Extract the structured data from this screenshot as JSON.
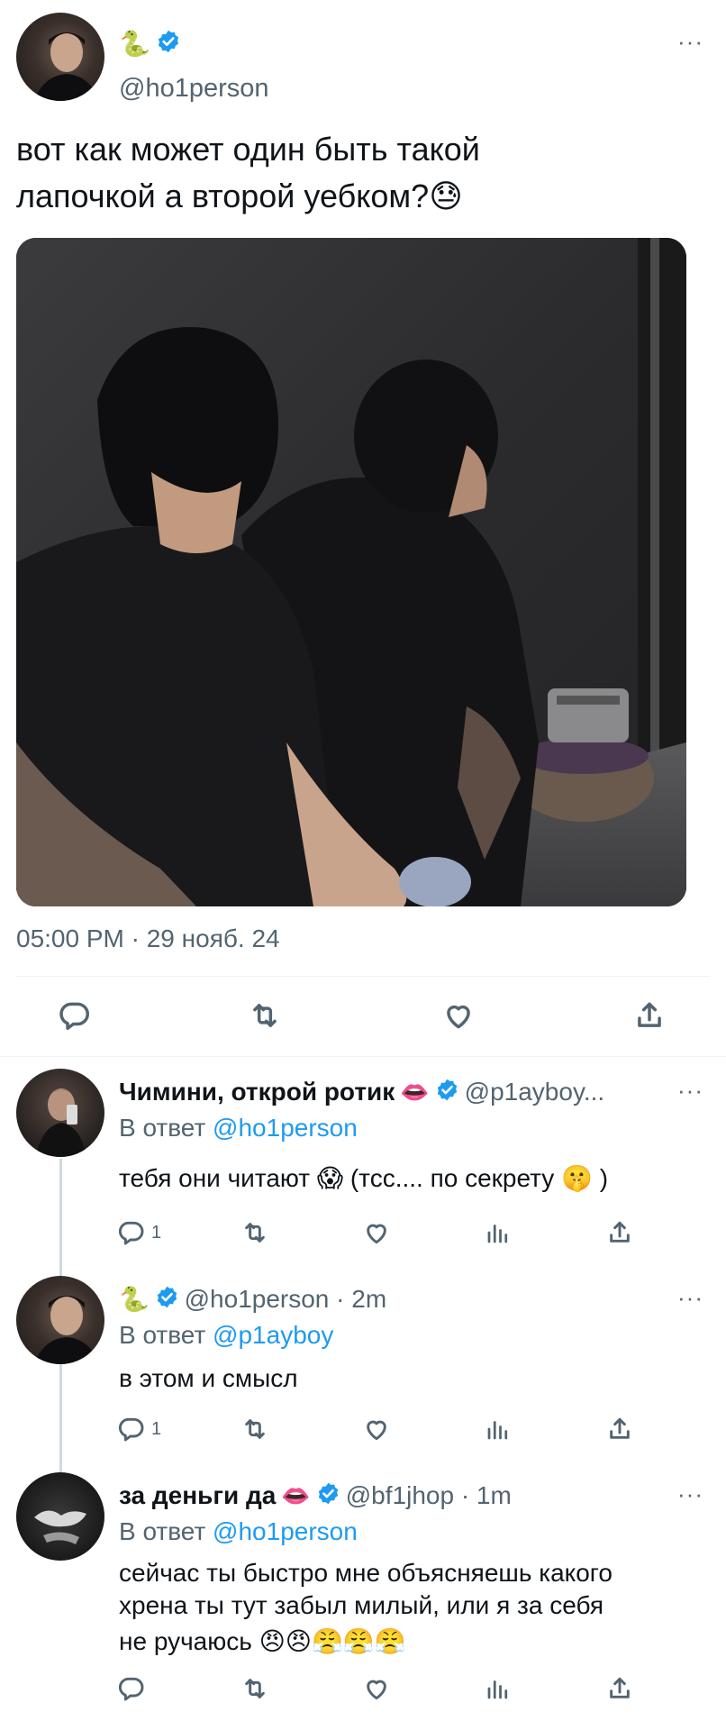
{
  "tweet": {
    "display_name": "🐍",
    "handle": "@ho1person",
    "text_line1": "вот как может один быть такой",
    "text_line2": "лапочкой а второй уебком?",
    "text_emoji": "😓",
    "timestamp": "05:00 PM · 29 нояб. 24",
    "more_label": "···",
    "photo_description_icon": "photo-two-men-black-shirts"
  },
  "replies": [
    {
      "display_name": "Чимини, открой ротик",
      "name_emoji": "👄",
      "handle": "@p1ayboy...",
      "reply_prefix": "В ответ",
      "reply_to": "@ho1person",
      "text_lines": [
        "тебя они читают 😱  (тсс.... по секрету 🤫 )"
      ],
      "reply_count": "1",
      "more_label": "···"
    },
    {
      "display_name": "🐍",
      "handle": "@ho1person · 2m",
      "reply_prefix": "В ответ",
      "reply_to": "@p1ayboy",
      "text_lines": [
        "в этом и смысл"
      ],
      "reply_count": "1",
      "more_label": "···"
    },
    {
      "display_name": "за деньги да",
      "name_emoji": "👄",
      "handle": "@bf1jhop · 1m",
      "reply_prefix": "В ответ",
      "reply_to": "@ho1person",
      "text_lines": [
        "сейчас ты быстро мне объясняешь какого",
        "хрена ты тут забыл милый, или я за себя",
        "не ручаюсь"
      ],
      "text_emojis": "😠😠😤😤😤",
      "reply_count": "",
      "more_label": "···"
    }
  ],
  "colors": {
    "accent": "#1d9bf0",
    "text": "#0f1419",
    "secondary": "#536471",
    "divider": "#eff3f4"
  },
  "icons": [
    "reply-icon",
    "retweet-icon",
    "like-icon",
    "share-icon",
    "views-icon",
    "verified-badge-icon",
    "more-icon"
  ]
}
